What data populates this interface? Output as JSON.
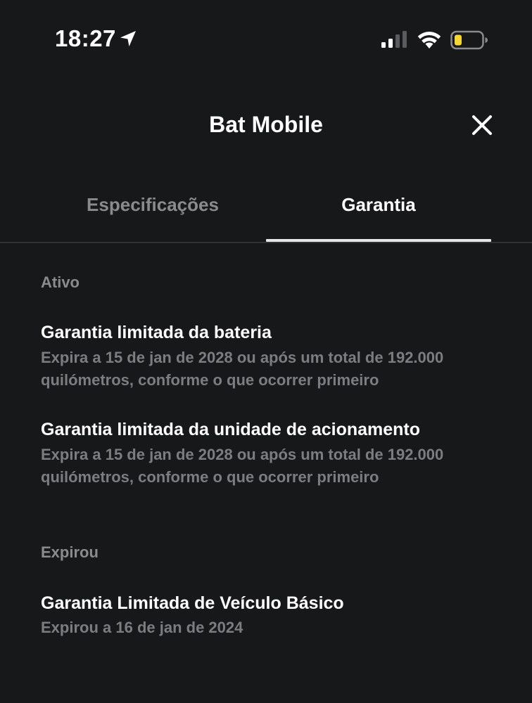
{
  "status_bar": {
    "time": "18:27",
    "icons": [
      "location-arrow-icon",
      "cellular-signal-icon",
      "wifi-icon",
      "battery-low-icon"
    ],
    "battery_color": "#f7d631"
  },
  "header": {
    "title": "Bat Mobile",
    "close_icon": "close-icon"
  },
  "tabs": [
    {
      "label": "Especificações",
      "active": false
    },
    {
      "label": "Garantia",
      "active": true
    }
  ],
  "sections": {
    "active": {
      "label": "Ativo",
      "items": [
        {
          "title": "Garantia limitada da bateria",
          "desc_line1": "Expira a 15 de jan de 2028 ou após um total de 192.000",
          "desc_line2": "quilómetros, conforme o que ocorrer primeiro"
        },
        {
          "title": "Garantia limitada da unidade de acionamento",
          "desc_line1": "Expira a 15 de jan de 2028 ou após um total de 192.000",
          "desc_line2": "quilómetros, conforme o que ocorrer primeiro"
        }
      ]
    },
    "expired": {
      "label": "Expirou",
      "items": [
        {
          "title": "Garantia Limitada de Veículo Básico",
          "desc_line1": "Expirou a 16 de jan de 2024"
        }
      ]
    }
  },
  "colors": {
    "background": "#17181a",
    "text_primary": "#ffffff",
    "text_secondary": "#7c7d80",
    "tab_inactive": "#8a8b8d",
    "tab_indicator": "#e6e6e6"
  }
}
